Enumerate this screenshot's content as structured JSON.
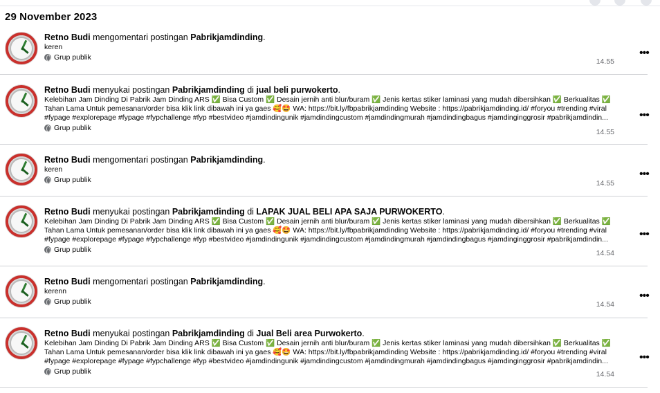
{
  "date_heading": "29 November 2023",
  "items": [
    {
      "actor": "Retno Budi",
      "verb": "mengomentari postingan",
      "page": "Pabrikjamdinding",
      "group_prefix": "",
      "group": "",
      "snippet": "keren",
      "privacy": "Grup publik",
      "time": "14.55"
    },
    {
      "actor": "Retno Budi",
      "verb": "menyukai postingan",
      "page": "Pabrikjamdinding",
      "group_prefix": "di",
      "group": "jual beli purwokerto",
      "snippet": "Kelebihan Jam Dinding Di Pabrik Jam Dinding ARS ✅ Bisa Custom ✅ Desain jernih anti blur/buram ✅ Jenis kertas stiker laminasi yang mudah dibersihkan ✅ Berkualitas ✅ Tahan Lama Untuk pemesanan/order bisa klik link dibawah ini ya gaes 🥰🤩 WA: https://bit.ly/fbpabrikjamdinding Website : https://pabrikjamdinding.id/ #foryou #trending #viral #fypage #explorepage #fypage #fypchallenge #fyp #bestvideo #jamdindingunik #jamdindingcustom #jamdindingmurah #jamdindingbagus #jamdinginggrosir #pabrikjamdindin...",
      "privacy": "Grup publik",
      "time": "14.55"
    },
    {
      "actor": "Retno Budi",
      "verb": "mengomentari postingan",
      "page": "Pabrikjamdinding",
      "group_prefix": "",
      "group": "",
      "snippet": "keren",
      "privacy": "Grup publik",
      "time": "14.55"
    },
    {
      "actor": "Retno Budi",
      "verb": "menyukai postingan",
      "page": "Pabrikjamdinding",
      "group_prefix": "di",
      "group": "LAPAK JUAL BELI APA SAJA PURWOKERTO",
      "snippet": "Kelebihan Jam Dinding Di Pabrik Jam Dinding ARS ✅ Bisa Custom ✅ Desain jernih anti blur/buram ✅ Jenis kertas stiker laminasi yang mudah dibersihkan ✅ Berkualitas ✅ Tahan Lama Untuk pemesanan/order bisa klik link dibawah ini ya gaes 🥰🤩 WA: https://bit.ly/fbpabrikjamdinding Website : https://pabrikjamdinding.id/ #foryou #trending #viral #fypage #explorepage #fypage #fypchallenge #fyp #bestvideo #jamdindingunik #jamdindingcustom #jamdindingmurah #jamdindingbagus #jamdinginggrosir #pabrikjamdindin...",
      "privacy": "Grup publik",
      "time": "14.54"
    },
    {
      "actor": "Retno Budi",
      "verb": "mengomentari postingan",
      "page": "Pabrikjamdinding",
      "group_prefix": "",
      "group": "",
      "snippet": "kerenn",
      "privacy": "Grup publik",
      "time": "14.54"
    },
    {
      "actor": "Retno Budi",
      "verb": "menyukai postingan",
      "page": "Pabrikjamdinding",
      "group_prefix": "di",
      "group": "Jual Beli area Purwokerto",
      "snippet": "Kelebihan Jam Dinding Di Pabrik Jam Dinding ARS ✅ Bisa Custom ✅ Desain jernih anti blur/buram ✅ Jenis kertas stiker laminasi yang mudah dibersihkan ✅ Berkualitas ✅ Tahan Lama Untuk pemesanan/order bisa klik link dibawah ini ya gaes 🥰🤩 WA: https://bit.ly/fbpabrikjamdinding Website : https://pabrikjamdinding.id/ #foryou #trending #viral #fypage #explorepage #fypage #fypchallenge #fyp #bestvideo #jamdindingunik #jamdindingcustom #jamdindingmurah #jamdindingbagus #jamdinginggrosir #pabrikjamdindin...",
      "privacy": "Grup publik",
      "time": "14.54"
    }
  ],
  "more_icon": "more-horizontal-icon",
  "privacy_icon": "globe-icon"
}
